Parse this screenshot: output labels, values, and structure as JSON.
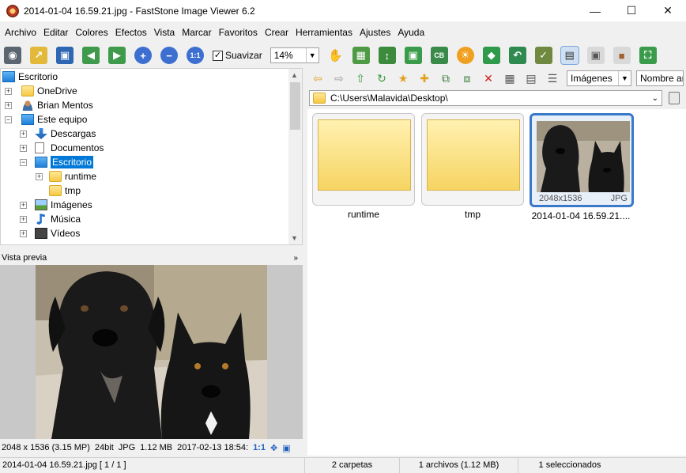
{
  "window": {
    "title": "2014-01-04 16.59.21.jpg  -  FastStone Image Viewer 6.2"
  },
  "menu": [
    "Archivo",
    "Editar",
    "Colores",
    "Efectos",
    "Vista",
    "Marcar",
    "Favoritos",
    "Crear",
    "Herramientas",
    "Ajustes",
    "Ayuda"
  ],
  "toolbar": {
    "smooth_label": "Suavizar",
    "zoom_value": "14%",
    "icons": [
      "camera-icon",
      "open-folder-icon",
      "save-icon",
      "prev-image-icon",
      "next-image-icon",
      "zoom-in-icon",
      "zoom-out-icon",
      "actual-size-icon"
    ],
    "right_icons": [
      "hand-icon",
      "slideshow-icon",
      "crop-icon",
      "resize-icon",
      "cb-icon",
      "brightness-icon",
      "stamp-icon",
      "undo-icon",
      "checklist-icon",
      "layout-1-icon",
      "layout-2-icon",
      "layout-3-icon",
      "fullscreen-icon"
    ]
  },
  "tree": {
    "items": [
      {
        "label": "Escritorio",
        "icon": "pc-icon",
        "level": 0,
        "expander": ""
      },
      {
        "label": "OneDrive",
        "icon": "folder-icon",
        "level": 1,
        "expander": "+"
      },
      {
        "label": "Brian Mentos",
        "icon": "user-icon",
        "level": 1,
        "expander": "+"
      },
      {
        "label": "Este equipo",
        "icon": "pc-icon",
        "level": 1,
        "expander": "−"
      },
      {
        "label": "Descargas",
        "icon": "download-icon",
        "level": 2,
        "expander": "+"
      },
      {
        "label": "Documentos",
        "icon": "document-icon",
        "level": 2,
        "expander": "+"
      },
      {
        "label": "Escritorio",
        "icon": "pc-icon",
        "level": 2,
        "expander": "−",
        "selected": true
      },
      {
        "label": "runtime",
        "icon": "folder-icon",
        "level": 3,
        "expander": "+"
      },
      {
        "label": "tmp",
        "icon": "folder-icon",
        "level": 3,
        "expander": ""
      },
      {
        "label": "Imágenes",
        "icon": "pictures-icon",
        "level": 2,
        "expander": "+"
      },
      {
        "label": "Música",
        "icon": "music-icon",
        "level": 2,
        "expander": "+"
      },
      {
        "label": "Vídeos",
        "icon": "video-icon",
        "level": 2,
        "expander": "+"
      }
    ]
  },
  "preview": {
    "title": "Vista previa",
    "dimensions": "2048 x 1536 (3.15 MP)",
    "bitdepth": "24bit",
    "format": "JPG",
    "size": "1.12 MB",
    "datetime": "2017-02-13 18:54:",
    "ratio": "1:1"
  },
  "browser": {
    "view_select": "Imágenes",
    "sort_select": "Nombre ar",
    "path": "C:\\Users\\Malavida\\Desktop\\",
    "thumbs": [
      {
        "label": "runtime",
        "type": "folder"
      },
      {
        "label": "tmp",
        "type": "folder"
      },
      {
        "label": "2014-01-04 16.59.21....",
        "type": "image",
        "dims": "2048x1536",
        "format": "JPG",
        "selected": true
      }
    ]
  },
  "status": {
    "file": "2014-01-04 16.59.21.jpg [ 1 / 1 ]",
    "folders": "2 carpetas",
    "files": "1 archivos (1.12 MB)",
    "selected": "1 seleccionados"
  }
}
